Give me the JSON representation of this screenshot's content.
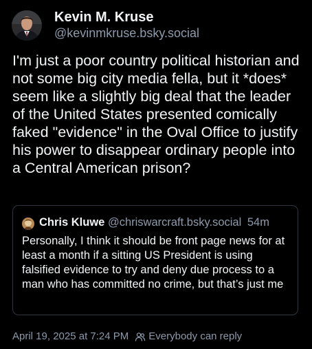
{
  "post": {
    "author": {
      "name": "Kevin M. Kruse",
      "handle": "@kevinmkruse.bsky.social"
    },
    "text": "I'm just a poor country political historian and not some big city media fella, but it *does* seem like a slightly big deal that the leader of the United States presented comically faked \"evidence\" in the Oval Office to justify his power to disappear ordinary people into a Central American prison?",
    "timestamp": "April 19, 2025 at 7:24 PM",
    "reply_setting": "Everybody can reply"
  },
  "quote": {
    "author": {
      "name": "Chris Kluwe",
      "handle": "@chriswarcraft.bsky.social"
    },
    "time": "54m",
    "text": "Personally, I think it should be front page news for at least a month if a sitting US President is using falsified evidence to try and deny due process to a man who has committed no crime, but that’s just me"
  },
  "icons": {
    "reply_setting_icon": "people-icon"
  },
  "colors": {
    "background": "#000000",
    "text_primary": "#f1f3f5",
    "text_secondary": "#8d9aab",
    "border": "#2e3640"
  }
}
